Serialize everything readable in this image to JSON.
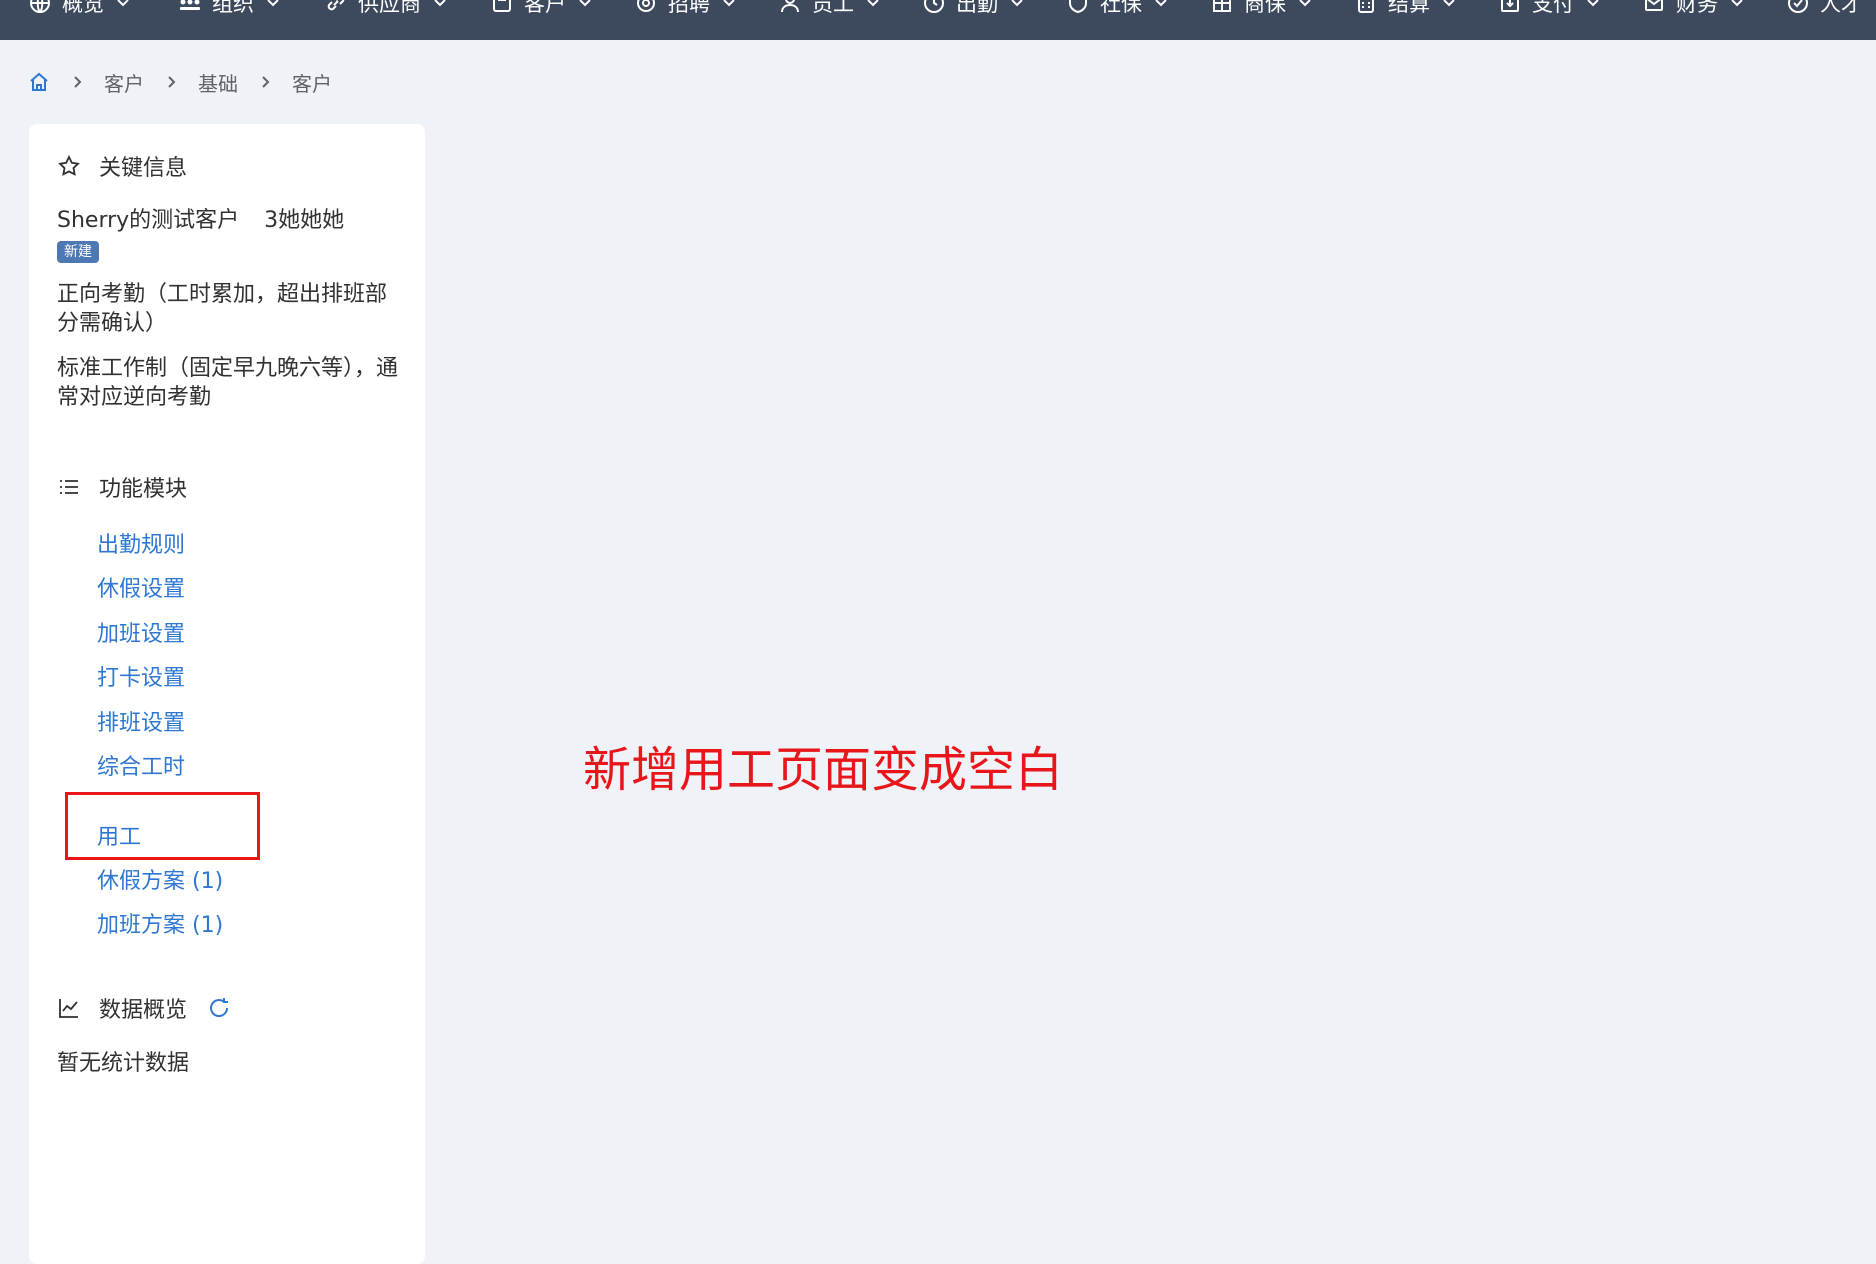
{
  "nav": {
    "items": [
      {
        "label": "概览",
        "icon": "globe-icon"
      },
      {
        "label": "组织",
        "icon": "org-icon"
      },
      {
        "label": "供应商",
        "icon": "link-icon"
      },
      {
        "label": "客户",
        "icon": "folder-icon"
      },
      {
        "label": "招聘",
        "icon": "settings-icon"
      },
      {
        "label": "员工",
        "icon": "user-icon"
      },
      {
        "label": "出勤",
        "icon": "clock-icon"
      },
      {
        "label": "社保",
        "icon": "shield-icon"
      },
      {
        "label": "商保",
        "icon": "grid-icon"
      },
      {
        "label": "结算",
        "icon": "calculator-icon"
      },
      {
        "label": "支付",
        "icon": "export-icon"
      },
      {
        "label": "财务",
        "icon": "mail-icon"
      },
      {
        "label": "人才",
        "icon": "check-circle-icon"
      }
    ]
  },
  "breadcrumb": {
    "items": [
      "客户",
      "基础",
      "客户"
    ]
  },
  "key_info": {
    "title": "关键信息",
    "customer_name": "Sherry的测试客户",
    "customer_alias": "3她她她",
    "status_badge": "新建",
    "attendance_mode": "正向考勤（工时累加，超出排班部分需确认）",
    "work_system": "标准工作制（固定早九晚六等），通常对应逆向考勤"
  },
  "modules": {
    "title": "功能模块",
    "items": [
      "出勤规则",
      "休假设置",
      "加班设置",
      "打卡设置",
      "排班设置",
      "综合工时",
      "用工",
      "休假方案 (1)",
      "加班方案 (1)"
    ]
  },
  "overview": {
    "title": "数据概览",
    "empty_text": "暂无统计数据"
  },
  "annotation": {
    "text": "新增用工页面变成空白"
  },
  "colors": {
    "nav_bg": "#3d4a5e",
    "page_bg": "#eff2f7",
    "link": "#2f77d1",
    "badge": "#4e78b4",
    "annotation": "#e8161b"
  }
}
